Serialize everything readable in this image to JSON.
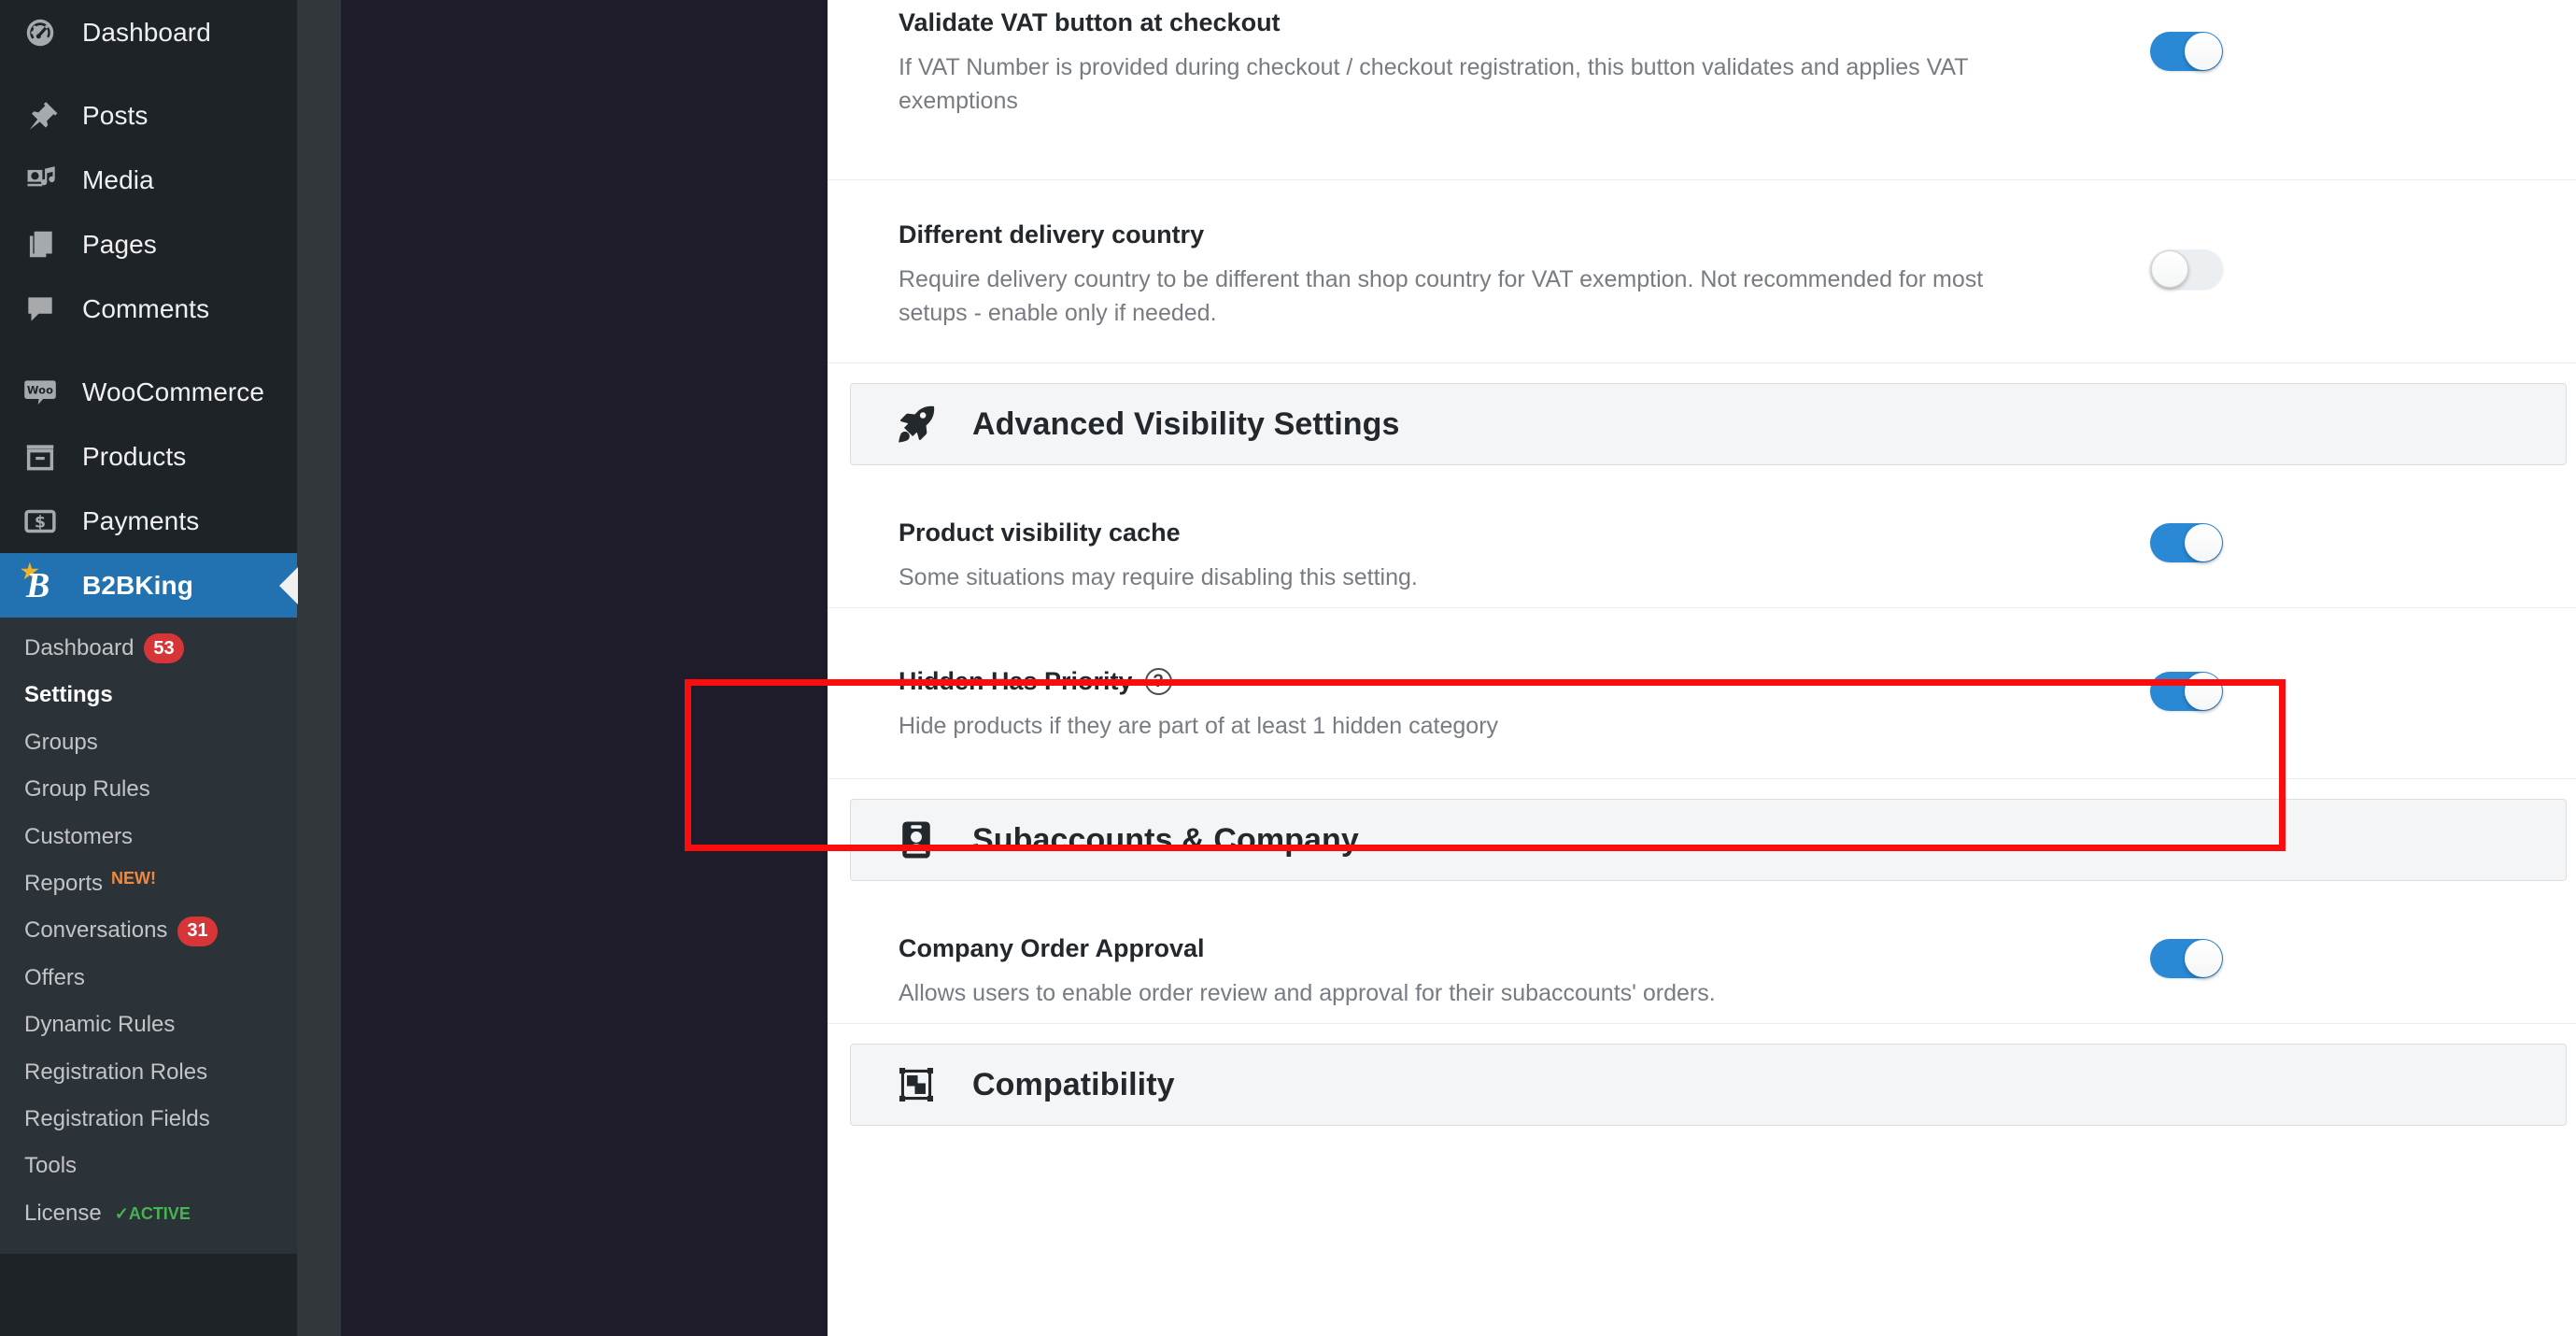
{
  "sidebar": {
    "primary_items": [
      {
        "label": "Dashboard",
        "icon": "dashboard-icon"
      },
      {
        "label": "Posts",
        "icon": "pin-icon"
      },
      {
        "label": "Media",
        "icon": "media-icon"
      },
      {
        "label": "Pages",
        "icon": "pages-icon"
      },
      {
        "label": "Comments",
        "icon": "comments-icon"
      },
      {
        "label": "WooCommerce",
        "icon": "woocommerce-icon"
      },
      {
        "label": "Products",
        "icon": "products-icon"
      },
      {
        "label": "Payments",
        "icon": "payments-icon"
      }
    ],
    "current_item": {
      "label": "B2BKing",
      "icon": "b2bking-icon"
    },
    "submenu": [
      {
        "label": "Dashboard",
        "badge": "53",
        "tag": "",
        "active": false
      },
      {
        "label": "Settings",
        "badge": "",
        "tag": "",
        "active": true
      },
      {
        "label": "Groups",
        "badge": "",
        "tag": "",
        "active": false
      },
      {
        "label": "Group Rules",
        "badge": "",
        "tag": "",
        "active": false
      },
      {
        "label": "Customers",
        "badge": "",
        "tag": "",
        "active": false
      },
      {
        "label": "Reports",
        "badge": "",
        "tag": "NEW!",
        "active": false
      },
      {
        "label": "Conversations",
        "badge": "31",
        "tag": "",
        "active": false
      },
      {
        "label": "Offers",
        "badge": "",
        "tag": "",
        "active": false
      },
      {
        "label": "Dynamic Rules",
        "badge": "",
        "tag": "",
        "active": false
      },
      {
        "label": "Registration Roles",
        "badge": "",
        "tag": "",
        "active": false
      },
      {
        "label": "Registration Fields",
        "badge": "",
        "tag": "",
        "active": false
      },
      {
        "label": "Tools",
        "badge": "",
        "tag": "",
        "active": false
      },
      {
        "label": "License",
        "badge": "",
        "tag": "✓ACTIVE",
        "active": false
      }
    ]
  },
  "settings": {
    "validate_vat": {
      "title": "Validate VAT button at checkout",
      "description": "If VAT Number is provided during checkout / checkout registration, this button validates and applies VAT exemptions",
      "toggle": "on"
    },
    "different_delivery_country": {
      "title": "Different delivery country",
      "description": "Require delivery country to be different than shop country for VAT exemption. Not recommended for most setups - enable only if needed.",
      "toggle": "off"
    },
    "advanced_visibility_header": {
      "title": "Advanced Visibility Settings",
      "icon": "rocket-icon"
    },
    "product_visibility_cache": {
      "title": "Product visibility cache",
      "description": "Some situations may require disabling this setting.",
      "toggle": "on"
    },
    "hidden_has_priority": {
      "title": "Hidden Has Priority",
      "help": "?",
      "description": "Hide products if they are part of at least 1 hidden category",
      "toggle": "on",
      "highlighted": true
    },
    "subaccounts_header": {
      "title": "Subaccounts & Company",
      "icon": "id-badge-icon"
    },
    "company_order_approval": {
      "title": "Company Order Approval",
      "description": "Allows users to enable order review and approval for their subaccounts' orders.",
      "toggle": "on"
    },
    "compatibility_header": {
      "title": "Compatibility",
      "icon": "frame-icon"
    }
  },
  "colors": {
    "accent_blue": "#2271b1",
    "toggle_on": "#2a88d4",
    "badge_red": "#d63638",
    "tag_orange": "#f0883e",
    "tag_green": "#46b450",
    "annotation_red": "#fc0d0d",
    "sidebar_dark": "#1d2327",
    "submenu_dark": "#2c3338"
  }
}
